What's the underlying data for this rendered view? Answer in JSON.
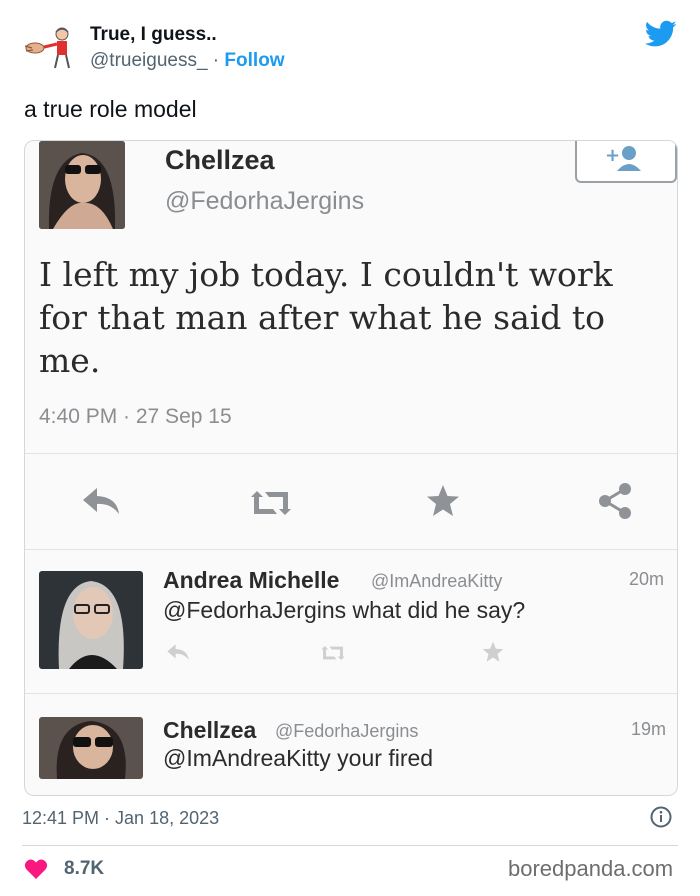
{
  "author": {
    "display_name": "True, I guess..",
    "handle": "@trueiguess_",
    "follow_label": "Follow",
    "separator": " · "
  },
  "tweet": {
    "text": "a true role model",
    "timestamp": "12:41 PM · Jan 18, 2023",
    "likes": "8.7K"
  },
  "embedded": {
    "main": {
      "name": "Chellzea",
      "handle": "@FedorhaJergins",
      "text": "I left my job today. I couldn't work for that man after what he said to me.",
      "time": "4:40 PM · 27 Sep 15"
    },
    "replies": [
      {
        "name": "Andrea Michelle",
        "handle": "@ImAndreaKitty",
        "text": "@FedorhaJergins what did he say?",
        "age": "20m"
      },
      {
        "name": "Chellzea",
        "handle": "@FedorhaJergins",
        "text": "@ImAndreaKitty your fired",
        "age": "19m"
      }
    ]
  },
  "watermark": "boredpanda.com",
  "colors": {
    "accent": "#1d9bf0",
    "like": "#f91880",
    "secondary": "#536471"
  },
  "icons": [
    "meme-avatar-icon",
    "twitter-bird-icon",
    "reply-icon",
    "retweet-icon",
    "favorite-icon",
    "share-icon",
    "follow-user-icon",
    "info-icon",
    "heart-icon"
  ]
}
